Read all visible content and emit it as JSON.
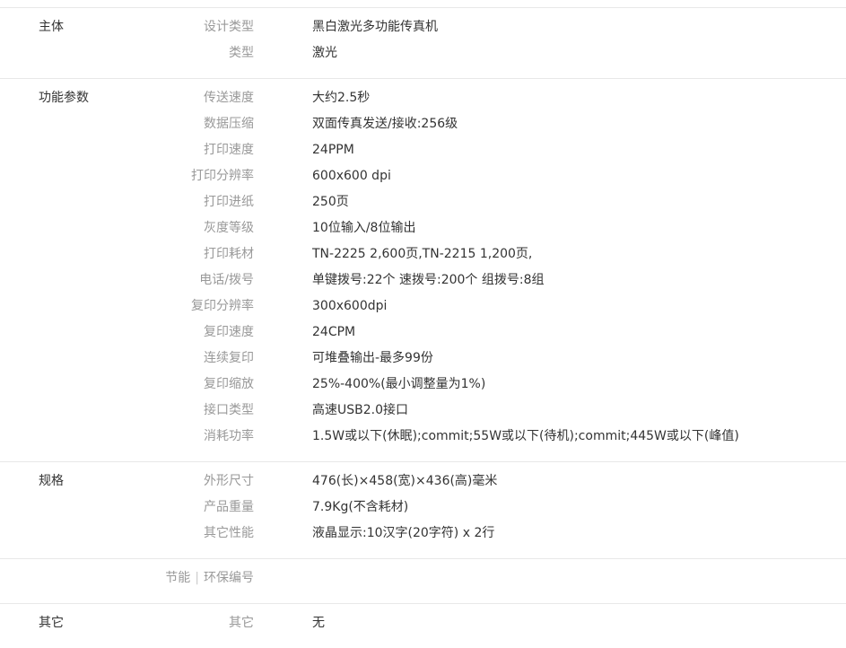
{
  "groups": [
    {
      "title": "主体",
      "rows": [
        {
          "label": "设计类型",
          "value": "黑白激光多功能传真机"
        },
        {
          "label": "类型",
          "value": "激光"
        }
      ]
    },
    {
      "title": "功能参数",
      "rows": [
        {
          "label": "传送速度",
          "value": "大约2.5秒"
        },
        {
          "label": "数据压缩",
          "value": "双面传真发送/接收:256级"
        },
        {
          "label": "打印速度",
          "value": "24PPM"
        },
        {
          "label": "打印分辨率",
          "value": "600x600 dpi"
        },
        {
          "label": "打印进纸",
          "value": "250页"
        },
        {
          "label": "灰度等级",
          "value": "10位输入/8位输出"
        },
        {
          "label": "打印耗材",
          "value": "TN-2225 2,600页,TN-2215 1,200页,"
        },
        {
          "label": "电话/拨号",
          "value": "单键拨号:22个 速拨号:200个 组拨号:8组"
        },
        {
          "label": "复印分辨率",
          "value": "300x600dpi"
        },
        {
          "label": "复印速度",
          "value": "24CPM"
        },
        {
          "label": "连续复印",
          "value": "可堆叠输出-最多99份"
        },
        {
          "label": "复印缩放",
          "value": "25%-400%(最小调整量为1%)"
        },
        {
          "label": "接口类型",
          "value": "高速USB2.0接口"
        },
        {
          "label": "消耗功率",
          "value": "1.5W或以下(休眠);commit;55W或以下(待机);commit;445W或以下(峰值)"
        }
      ]
    },
    {
      "title": "规格",
      "rows": [
        {
          "label": "外形尺寸",
          "value": "476(长)×458(宽)×436(高)毫米"
        },
        {
          "label": "产品重量",
          "value": "7.9Kg(不含耗材)"
        },
        {
          "label": "其它性能",
          "value": "液晶显示:10汉字(20字符) x 2行"
        }
      ]
    },
    {
      "title": "",
      "rows": [
        {
          "label_a": "节能",
          "label_sep": "|",
          "label_b": "环保编号",
          "value": ""
        }
      ]
    },
    {
      "title": "其它",
      "rows": [
        {
          "label": "其它",
          "value": "无"
        }
      ]
    }
  ]
}
